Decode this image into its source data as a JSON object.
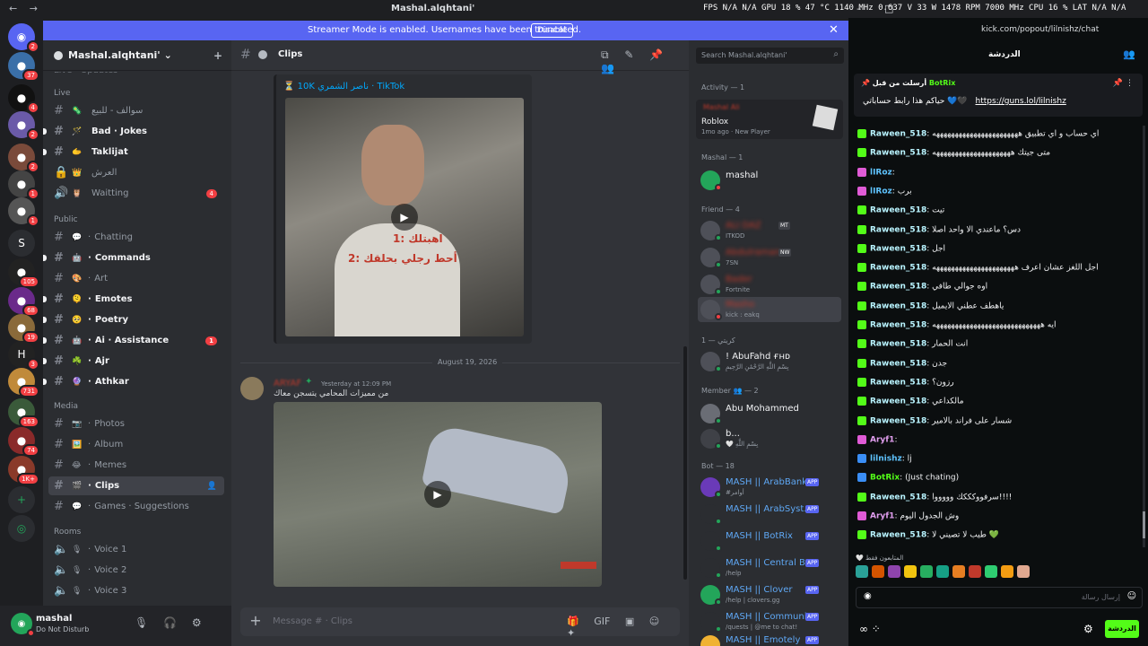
{
  "titlebar": {
    "nav_back": "←",
    "nav_forward": "→",
    "window_title": "Mashal.alqhtani'",
    "stats": "FPS  N/A  N/A    GPU 18 % 47 °C 1140 MHz 0.637 V 33 W 1478 RPM 7000 MHz   CPU 16 %    LAT  N/A  N/A",
    "chrome_title": "kick.com/popout/lilnishz/chat - Google Chrome",
    "win_minimize": "–",
    "win_maximize": "□",
    "win_close": "✕"
  },
  "banner": {
    "text": "Streamer Mode is enabled. Usernames have been truncated.",
    "button": "Disable",
    "close": "✕"
  },
  "rail": {
    "servers": [
      {
        "glyph": "◉",
        "color": "#5865f2",
        "badge": "2"
      },
      {
        "glyph": "●",
        "color": "#3a6fa8",
        "badge": "37"
      },
      {
        "glyph": "●",
        "color": "#111111",
        "badge": "4"
      },
      {
        "glyph": "●",
        "color": "#6a5aa8",
        "badge": "2"
      },
      {
        "glyph": "●",
        "color": "#7a4a3a",
        "badge": "2"
      },
      {
        "glyph": "●",
        "color": "#444444",
        "badge": "1"
      },
      {
        "glyph": "●",
        "color": "#555555",
        "badge": "1"
      },
      {
        "glyph": "S",
        "color": "#2b2d31",
        "badge": ""
      },
      {
        "glyph": "●",
        "color": "#222222",
        "badge": "105"
      },
      {
        "glyph": "●",
        "color": "#6a2a8a",
        "badge": "68"
      },
      {
        "glyph": "●",
        "color": "#8a6a3a",
        "badge": "19"
      },
      {
        "glyph": "H",
        "color": "#222222",
        "badge": "3"
      },
      {
        "glyph": "●",
        "color": "#c08a3a",
        "badge": "731"
      },
      {
        "glyph": "●",
        "color": "#3a5a3a",
        "badge": "163"
      },
      {
        "glyph": "●",
        "color": "#8a2a2a",
        "badge": "74"
      },
      {
        "glyph": "●",
        "color": "#8a3a2a",
        "badge": "1K+"
      }
    ],
    "add": "+",
    "discover": "◎"
  },
  "guild": {
    "name": "Mashal.alqhtani'",
    "chevron": "⌄",
    "add_member_icon": "+",
    "category_live": "Live",
    "category_live_emoji": "✨",
    "category_public": "Public",
    "category_media": "Media",
    "category_rooms": "Rooms",
    "channels_live": [
      {
        "emoji": "🦠",
        "name": "سوالف - للبيع",
        "bold": false,
        "mention": "",
        "hash": "#"
      },
      {
        "emoji": "🪄",
        "name": "Bad · Jokes",
        "bold": true,
        "mention": "",
        "hash": "#"
      },
      {
        "emoji": "🫱",
        "name": "Taklijat",
        "bold": true,
        "mention": "",
        "hash": "#"
      },
      {
        "emoji": "👑",
        "name": "العرش",
        "bold": false,
        "mention": "",
        "hash": "🔒"
      },
      {
        "emoji": "🦉",
        "name": "Waitting",
        "bold": false,
        "mention": "4",
        "hash": "🔊"
      }
    ],
    "channels_public": [
      {
        "emoji": "💬",
        "name": "Chatting",
        "bold": false,
        "mention": ""
      },
      {
        "emoji": "🤖",
        "name": "Commands",
        "bold": true,
        "mention": ""
      },
      {
        "emoji": "🎨",
        "name": "Art",
        "bold": false,
        "mention": ""
      },
      {
        "emoji": "🫠",
        "name": "Emotes",
        "bold": true,
        "mention": ""
      },
      {
        "emoji": "🥺",
        "name": "Poetry",
        "bold": true,
        "mention": ""
      },
      {
        "emoji": "🤖",
        "name": "Ai · Assistance",
        "bold": true,
        "mention": "1"
      },
      {
        "emoji": "☘️",
        "name": "Ajr",
        "bold": true,
        "mention": ""
      },
      {
        "emoji": "🔮",
        "name": "Athkar",
        "bold": true,
        "mention": ""
      }
    ],
    "channels_media": [
      {
        "emoji": "📷",
        "name": "Photos",
        "bold": false,
        "active": false
      },
      {
        "emoji": "🖼️",
        "name": "Album",
        "bold": false,
        "active": false
      },
      {
        "emoji": "😂",
        "name": "Memes",
        "bold": false,
        "active": false
      },
      {
        "emoji": "🎬",
        "name": "Clips",
        "bold": true,
        "active": true
      },
      {
        "emoji": "💬",
        "name": "Games · Suggestions",
        "bold": false,
        "active": false
      }
    ],
    "channels_rooms": [
      {
        "name": "Voice 1"
      },
      {
        "name": "Voice 2"
      },
      {
        "name": "Voice 3"
      }
    ],
    "partial_top": "Live · Updates"
  },
  "user": {
    "name": "mashal",
    "status": "Do Not Disturb",
    "mic": "🎙",
    "headset": "🎧",
    "settings": "⚙"
  },
  "chat": {
    "channel": "Clips",
    "header_icons": [
      "⧉",
      "✎",
      "📌",
      "👥"
    ],
    "embed_title": "⏳ 10K ناصر الشمري · TikTok",
    "video_caption_1": "1: اهبتلك",
    "video_caption_2": "2: أحط رجلي بحلقك",
    "date_divider": "August 19, 2026",
    "msg_author": "ARYAF",
    "msg_badge": "✦",
    "msg_time": "Yesterday at 12:09 PM",
    "msg_text": "من مميزات المحامي يتسجن معاك",
    "play_glyph": "▶",
    "composer_plus": "+",
    "composer_placeholder": "Message # · Clips",
    "composer_icons": [
      "🎁",
      "GIF",
      "▣",
      "☺",
      "✦"
    ]
  },
  "members": {
    "search_placeholder": "Search Mashal.alqhtani'",
    "search_icon": "⌕",
    "activity_header": "Activity — 1",
    "activity_name": "Mashal Ali",
    "activity_game": "Roblox",
    "activity_meta": "1mo ago  ·  New Player",
    "cat_mashal": "Mashal — 1",
    "mashal_member": "mashal",
    "cat_friend": "Friend — 4",
    "friends": [
      {
        "name": "ALI DAZ",
        "tag": "MT",
        "sub": "ITKOD",
        "color": "#23a55a"
      },
      {
        "name": "Abdulraman",
        "tag": "NW",
        "sub": "7SN",
        "color": "#23a55a"
      },
      {
        "name": "Bader",
        "tag": "",
        "sub": "Fortnite",
        "color": "#23a55a"
      },
      {
        "name": "Masho",
        "tag": "",
        "sub": "kick : eakq",
        "color": "#f23f43"
      }
    ],
    "cat_kuraiti": "كريتي — 1",
    "kuraiti_member": "! AbuFahd ғнᴅ",
    "kuraiti_sub": "بِسْمِ اللَّهِ الرَّحْمَٰنِ الرَّحِيمِ",
    "cat_member": "Member 👥 — 2",
    "member1": "Abu Mohammed",
    "member2": "b...",
    "member2_sub": "🤍 بِسْمِ اللَّهِ",
    "cat_bot": "Bot — 18",
    "app_label": "APP",
    "bots": [
      {
        "name": "MASH || ArabBank",
        "sub": "#أوامر",
        "color": "#6a3ab8"
      },
      {
        "name": "MASH || ArabSyst...",
        "sub": "",
        "color": "#2b2d31"
      },
      {
        "name": "MASH || BotRix",
        "sub": "",
        "color": "#2b2d31"
      },
      {
        "name": "MASH || Central B...",
        "sub": "/help",
        "color": "#2b2d31"
      },
      {
        "name": "MASH || Clover",
        "sub": "/help | clovers.gg",
        "color": "#23a55a"
      },
      {
        "name": "MASH || Communi...",
        "sub": "/quests | @me to chat!",
        "color": "#2b2d31"
      },
      {
        "name": "MASH || Emotely",
        "sub": "",
        "color": "#f0b232"
      }
    ]
  },
  "kick": {
    "url": "kick.com/popout/lilnishz/chat",
    "title": "الدردشة",
    "users_icon": "👥",
    "pinned_by": "أرسلت من قبل",
    "pinned_bot": "BotRix",
    "pinned_text": "حياكم هذا رابط حساباتي 💙🖤",
    "pinned_link": "https://guns.lol/lilnishz",
    "pin_icons": "📌 ⋮",
    "lines": [
      {
        "user": "Raween_518",
        "text": "اي حساب و اي تطبيق هههههههههههههههههههههههه",
        "badge": "",
        "uclass": ""
      },
      {
        "user": "Raween_518",
        "text": "متى جيتك هههههههههههههههههههههه",
        "badge": "",
        "uclass": ""
      },
      {
        "user": "lIRoz",
        "text": "",
        "badge": "pink",
        "uclass": "blue"
      },
      {
        "user": "lIRoz",
        "text": "برب",
        "badge": "pink",
        "uclass": "blue"
      },
      {
        "user": "Raween_518",
        "text": "تيت",
        "badge": "",
        "uclass": ""
      },
      {
        "user": "Raween_518",
        "text": "دس؟ ماعندي الا واحد اصلا",
        "badge": "",
        "uclass": ""
      },
      {
        "user": "Raween_518",
        "text": "اجل",
        "badge": "",
        "uclass": ""
      },
      {
        "user": "Raween_518",
        "text": "اجل اللغز عشان اعرف ههههههههههههههههههههههه",
        "badge": "",
        "uclass": ""
      },
      {
        "user": "Raween_518",
        "text": "اوه جوالي طافي",
        "badge": "",
        "uclass": ""
      },
      {
        "user": "Raween_518",
        "text": "ياهطف عطني الايميل",
        "badge": "",
        "uclass": ""
      },
      {
        "user": "Raween_518",
        "text": "ايه هههههههههههههههههههههههههههههه",
        "badge": "",
        "uclass": ""
      },
      {
        "user": "Raween_518",
        "text": "انت الحمار",
        "badge": "",
        "uclass": ""
      },
      {
        "user": "Raween_518",
        "text": "جدن",
        "badge": "",
        "uclass": ""
      },
      {
        "user": "Raween_518",
        "text": "رزون؟",
        "badge": "",
        "uclass": ""
      },
      {
        "user": "Raween_518",
        "text": "مالكداعي",
        "badge": "",
        "uclass": ""
      },
      {
        "user": "Raween_518",
        "text": "شسار على فراند بالامير",
        "badge": "",
        "uclass": ""
      },
      {
        "user": "Aryf1",
        "text": "",
        "badge": "pink",
        "uclass": "pink"
      },
      {
        "user": "lilnishz",
        "text": "lj",
        "badge": "blue",
        "uclass": "blue"
      },
      {
        "user": "BotRix",
        "text": "(Just chating)",
        "badge": "blue",
        "uclass": "green"
      },
      {
        "user": "Raween_518",
        "text": "سرفووكككك وووووا!!!!",
        "badge": "",
        "uclass": ""
      },
      {
        "user": "Aryf1",
        "text": "وش الجدول اليوم",
        "badge": "pink",
        "uclass": "pink"
      },
      {
        "user": "Raween_518",
        "text": "طيب لا تصيني لا 💚",
        "badge": "",
        "uclass": ""
      }
    ],
    "emote_caption": "🤍 المتابعون فقط",
    "emote_colors": [
      "#2aa198",
      "#d35400",
      "#8e44ad",
      "#f1c40f",
      "#27ae60",
      "#16a085",
      "#e67e22",
      "#c0392b",
      "#2ecc71",
      "#f39c12",
      "#e0a890"
    ],
    "input_placeholder": "إرسال رسالة",
    "input_smile": "☺",
    "input_left": "◉",
    "foot_infinity": "∞ ⁘",
    "foot_gear": "⚙",
    "send": "الدردشة"
  }
}
